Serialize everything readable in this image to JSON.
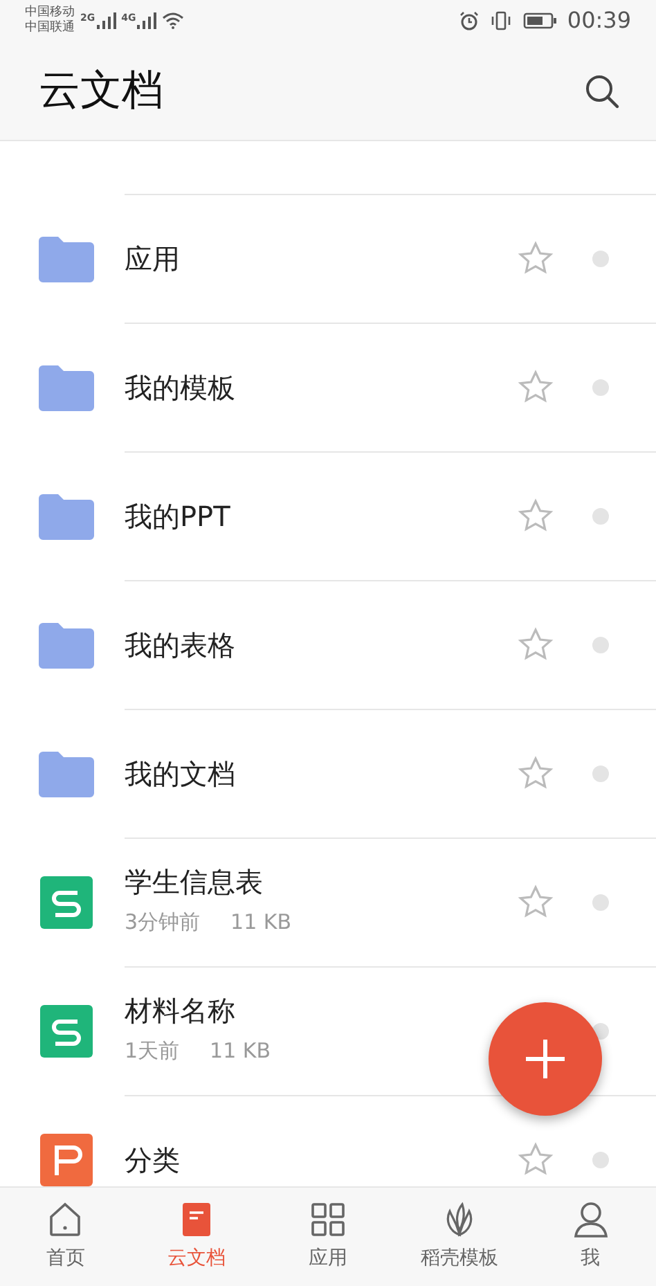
{
  "status_bar": {
    "carriers": [
      "中国移动",
      "中国联通"
    ],
    "networks": [
      "2G",
      "4G"
    ],
    "time": "00:39"
  },
  "header": {
    "title": "云文档"
  },
  "files": [
    {
      "kind": "folder",
      "name": "应用",
      "starred": false
    },
    {
      "kind": "folder",
      "name": "我的模板",
      "starred": false
    },
    {
      "kind": "folder",
      "name": "我的PPT",
      "starred": false
    },
    {
      "kind": "folder",
      "name": "我的表格",
      "starred": false
    },
    {
      "kind": "folder",
      "name": "我的文档",
      "starred": false
    },
    {
      "kind": "sheet",
      "name": "学生信息表",
      "time": "3分钟前",
      "size": "11 KB",
      "starred": false
    },
    {
      "kind": "sheet",
      "name": "材料名称",
      "time": "1天前",
      "size": "11 KB"
    },
    {
      "kind": "slides",
      "name": "分类",
      "starred": false
    }
  ],
  "tabs": [
    {
      "kind": "home",
      "label": "首页",
      "selected": false
    },
    {
      "kind": "doc",
      "label": "云文档",
      "selected": true
    },
    {
      "kind": "apps",
      "label": "应用",
      "selected": false
    },
    {
      "kind": "leaf",
      "label": "稻壳模板",
      "selected": false
    },
    {
      "kind": "person",
      "label": "我",
      "selected": false
    }
  ]
}
